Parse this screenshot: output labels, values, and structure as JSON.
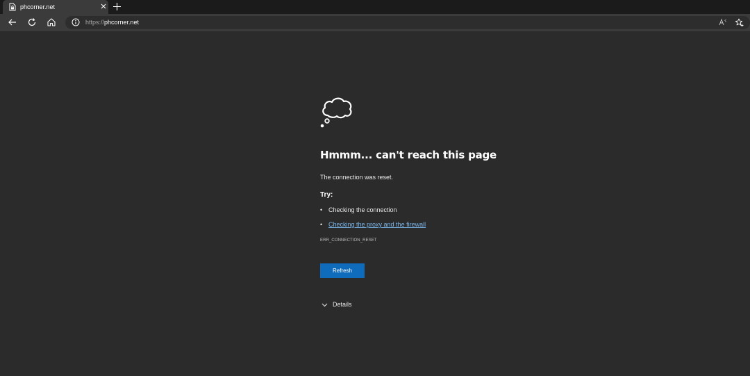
{
  "tab": {
    "title": "phcorner.net",
    "favicon": "page-lock-icon",
    "close_icon": "close-icon"
  },
  "newtab_icon": "plus-icon",
  "toolbar": {
    "back_icon": "back-arrow-icon",
    "refresh_icon": "refresh-icon",
    "home_icon": "home-icon",
    "info_icon": "info-icon",
    "url_scheme": "https://",
    "url_host": "phcorner.net",
    "read_aloud_icon": "read-aloud-icon",
    "favorites_icon": "add-favorite-icon"
  },
  "error": {
    "icon": "cloud-thought-icon",
    "title": "Hmmm... can't reach this page",
    "description": "The connection was reset.",
    "try_label": "Try:",
    "suggestions": [
      {
        "text": "Checking the connection",
        "is_link": false
      },
      {
        "text": "Checking the proxy and the firewall",
        "is_link": true
      }
    ],
    "code": "ERR_CONNECTION_RESET",
    "refresh_label": "Refresh",
    "details_label": "Details"
  },
  "colors": {
    "background": "#2b2b2b",
    "tabstrip": "#1b1b1b",
    "toolbar": "#3b3b3b",
    "accent": "#0f6cbd",
    "link": "#79b4e8"
  }
}
